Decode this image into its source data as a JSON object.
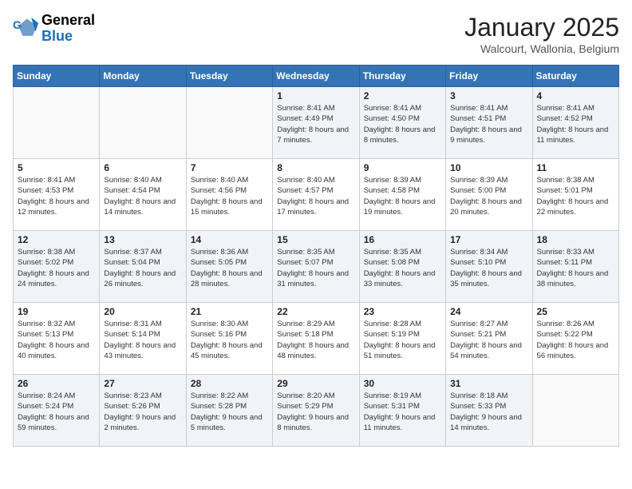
{
  "header": {
    "logo_line1": "General",
    "logo_line2": "Blue",
    "month": "January 2025",
    "location": "Walcourt, Wallonia, Belgium"
  },
  "weekdays": [
    "Sunday",
    "Monday",
    "Tuesday",
    "Wednesday",
    "Thursday",
    "Friday",
    "Saturday"
  ],
  "weeks": [
    [
      {
        "day": "",
        "info": ""
      },
      {
        "day": "",
        "info": ""
      },
      {
        "day": "",
        "info": ""
      },
      {
        "day": "1",
        "info": "Sunrise: 8:41 AM\nSunset: 4:49 PM\nDaylight: 8 hours\nand 7 minutes."
      },
      {
        "day": "2",
        "info": "Sunrise: 8:41 AM\nSunset: 4:50 PM\nDaylight: 8 hours\nand 8 minutes."
      },
      {
        "day": "3",
        "info": "Sunrise: 8:41 AM\nSunset: 4:51 PM\nDaylight: 8 hours\nand 9 minutes."
      },
      {
        "day": "4",
        "info": "Sunrise: 8:41 AM\nSunset: 4:52 PM\nDaylight: 8 hours\nand 11 minutes."
      }
    ],
    [
      {
        "day": "5",
        "info": "Sunrise: 8:41 AM\nSunset: 4:53 PM\nDaylight: 8 hours\nand 12 minutes."
      },
      {
        "day": "6",
        "info": "Sunrise: 8:40 AM\nSunset: 4:54 PM\nDaylight: 8 hours\nand 14 minutes."
      },
      {
        "day": "7",
        "info": "Sunrise: 8:40 AM\nSunset: 4:56 PM\nDaylight: 8 hours\nand 15 minutes."
      },
      {
        "day": "8",
        "info": "Sunrise: 8:40 AM\nSunset: 4:57 PM\nDaylight: 8 hours\nand 17 minutes."
      },
      {
        "day": "9",
        "info": "Sunrise: 8:39 AM\nSunset: 4:58 PM\nDaylight: 8 hours\nand 19 minutes."
      },
      {
        "day": "10",
        "info": "Sunrise: 8:39 AM\nSunset: 5:00 PM\nDaylight: 8 hours\nand 20 minutes."
      },
      {
        "day": "11",
        "info": "Sunrise: 8:38 AM\nSunset: 5:01 PM\nDaylight: 8 hours\nand 22 minutes."
      }
    ],
    [
      {
        "day": "12",
        "info": "Sunrise: 8:38 AM\nSunset: 5:02 PM\nDaylight: 8 hours\nand 24 minutes."
      },
      {
        "day": "13",
        "info": "Sunrise: 8:37 AM\nSunset: 5:04 PM\nDaylight: 8 hours\nand 26 minutes."
      },
      {
        "day": "14",
        "info": "Sunrise: 8:36 AM\nSunset: 5:05 PM\nDaylight: 8 hours\nand 28 minutes."
      },
      {
        "day": "15",
        "info": "Sunrise: 8:35 AM\nSunset: 5:07 PM\nDaylight: 8 hours\nand 31 minutes."
      },
      {
        "day": "16",
        "info": "Sunrise: 8:35 AM\nSunset: 5:08 PM\nDaylight: 8 hours\nand 33 minutes."
      },
      {
        "day": "17",
        "info": "Sunrise: 8:34 AM\nSunset: 5:10 PM\nDaylight: 8 hours\nand 35 minutes."
      },
      {
        "day": "18",
        "info": "Sunrise: 8:33 AM\nSunset: 5:11 PM\nDaylight: 8 hours\nand 38 minutes."
      }
    ],
    [
      {
        "day": "19",
        "info": "Sunrise: 8:32 AM\nSunset: 5:13 PM\nDaylight: 8 hours\nand 40 minutes."
      },
      {
        "day": "20",
        "info": "Sunrise: 8:31 AM\nSunset: 5:14 PM\nDaylight: 8 hours\nand 43 minutes."
      },
      {
        "day": "21",
        "info": "Sunrise: 8:30 AM\nSunset: 5:16 PM\nDaylight: 8 hours\nand 45 minutes."
      },
      {
        "day": "22",
        "info": "Sunrise: 8:29 AM\nSunset: 5:18 PM\nDaylight: 8 hours\nand 48 minutes."
      },
      {
        "day": "23",
        "info": "Sunrise: 8:28 AM\nSunset: 5:19 PM\nDaylight: 8 hours\nand 51 minutes."
      },
      {
        "day": "24",
        "info": "Sunrise: 8:27 AM\nSunset: 5:21 PM\nDaylight: 8 hours\nand 54 minutes."
      },
      {
        "day": "25",
        "info": "Sunrise: 8:26 AM\nSunset: 5:22 PM\nDaylight: 8 hours\nand 56 minutes."
      }
    ],
    [
      {
        "day": "26",
        "info": "Sunrise: 8:24 AM\nSunset: 5:24 PM\nDaylight: 8 hours\nand 59 minutes."
      },
      {
        "day": "27",
        "info": "Sunrise: 8:23 AM\nSunset: 5:26 PM\nDaylight: 9 hours\nand 2 minutes."
      },
      {
        "day": "28",
        "info": "Sunrise: 8:22 AM\nSunset: 5:28 PM\nDaylight: 9 hours\nand 5 minutes."
      },
      {
        "day": "29",
        "info": "Sunrise: 8:20 AM\nSunset: 5:29 PM\nDaylight: 9 hours\nand 8 minutes."
      },
      {
        "day": "30",
        "info": "Sunrise: 8:19 AM\nSunset: 5:31 PM\nDaylight: 9 hours\nand 11 minutes."
      },
      {
        "day": "31",
        "info": "Sunrise: 8:18 AM\nSunset: 5:33 PM\nDaylight: 9 hours\nand 14 minutes."
      },
      {
        "day": "",
        "info": ""
      }
    ]
  ]
}
